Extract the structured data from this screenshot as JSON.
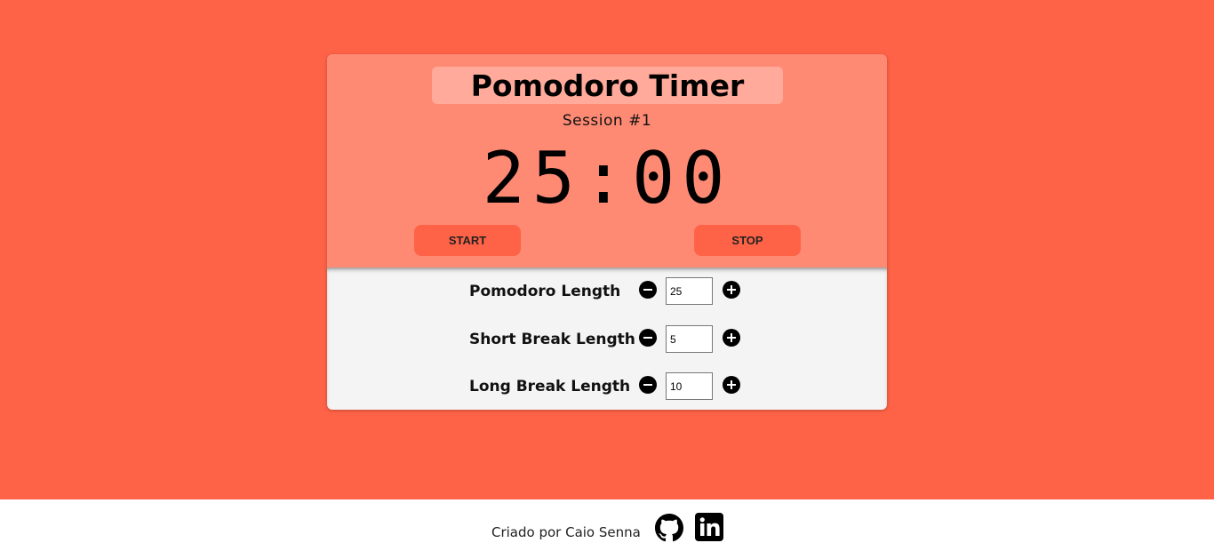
{
  "app": {
    "title": "Pomodoro Timer",
    "session": "Session #1",
    "time": "25:00"
  },
  "controls": {
    "start_label": "START",
    "stop_label": "STOP"
  },
  "settings": [
    {
      "label": "Pomodoro Length",
      "value": "25"
    },
    {
      "label": "Short Break Length",
      "value": "5"
    },
    {
      "label": "Long Break Length",
      "value": "10"
    }
  ],
  "footer": {
    "credit": "Criado por Caio Senna",
    "icons": [
      "github-icon",
      "linkedin-icon"
    ]
  },
  "colors": {
    "background": "#ff6347",
    "timer_panel": "#ff8a74",
    "title_box": "#ffaa9b",
    "settings_panel": "#f4f4f4"
  }
}
